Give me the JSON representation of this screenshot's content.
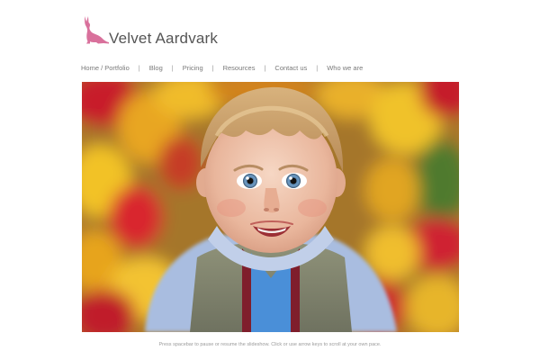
{
  "brand": {
    "name": "Velvet Aardvark",
    "logo_icon": "kangaroo-icon",
    "logo_color": "#d9719c"
  },
  "nav": {
    "items": [
      {
        "label": "Home / Portfolio"
      },
      {
        "label": "Blog"
      },
      {
        "label": "Pricing"
      },
      {
        "label": "Resources"
      },
      {
        "label": "Contact us"
      },
      {
        "label": "Who we are"
      }
    ],
    "separator": "|"
  },
  "slideshow": {
    "image_subject": "portrait of a smiling blond toddler in a blue hoodie and olive vest in front of red and yellow tulips",
    "caption": "Press spacebar to pause or resume the slideshow. Click or use arrow keys to scroll at your own pace."
  }
}
